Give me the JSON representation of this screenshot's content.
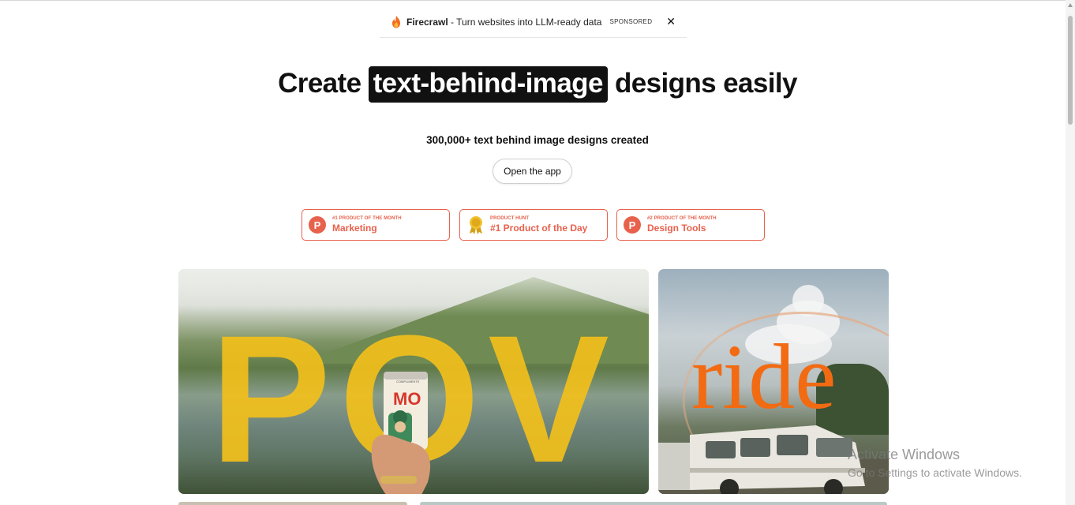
{
  "sponsor": {
    "brand": "Firecrawl",
    "text": " - Turn websites into LLM-ready data",
    "tag": "SPONSORED",
    "close": "✕"
  },
  "hero": {
    "headline_before": "Create",
    "headline_highlight": "text-behind-image",
    "headline_after": "designs easily",
    "subline": "300,000+ text behind image designs created",
    "cta": "Open the app"
  },
  "badges": [
    {
      "icon": "product-hunt-icon",
      "small": "#1 PRODUCT OF THE MONTH",
      "big": "Marketing"
    },
    {
      "icon": "medal-icon",
      "small": "PRODUCT HUNT",
      "big": "#1 Product of the Day"
    },
    {
      "icon": "product-hunt-icon",
      "small": "#2 PRODUCT OF THE MONTH",
      "big": "Design Tools"
    }
  ],
  "gallery": {
    "pov_text": "POV",
    "can_label": "MO",
    "can_small": "COMPLIMENTS",
    "ride_text": "ride"
  },
  "watermark": {
    "line1": "Activate Windows",
    "line2": "Go to Settings to activate Windows."
  },
  "colors": {
    "accent": "#e8614d",
    "pov_yellow": "#f2c01b",
    "ride_orange": "#f26a12"
  }
}
